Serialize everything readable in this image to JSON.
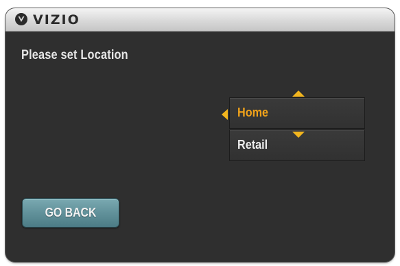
{
  "header": {
    "brand": "VIZIO",
    "logo_icon": "vizio-v-logo-icon"
  },
  "main": {
    "prompt": "Please set Location",
    "options": [
      {
        "label": "Home",
        "selected": true
      },
      {
        "label": "Retail",
        "selected": false
      }
    ],
    "back_button": "GO BACK"
  },
  "colors": {
    "selected_text": "#f0a21a",
    "arrow": "#f2b51e",
    "button": "#5f8f98",
    "panel": "#2f2f2f"
  },
  "icons": [
    "arrow-up-icon",
    "arrow-left-icon",
    "arrow-down-icon"
  ]
}
